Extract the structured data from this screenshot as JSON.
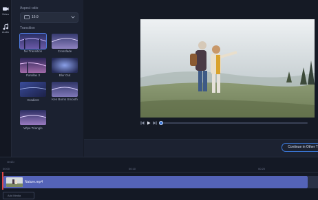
{
  "sidebar": {
    "items": [
      {
        "label": "Video",
        "icon": "video-icon"
      },
      {
        "label": "Audio",
        "icon": "music-note-icon"
      }
    ]
  },
  "panel": {
    "aspect_ratio_label": "Aspect ratio",
    "aspect_ratio_value": "16:9",
    "transition_label": "Transition",
    "transitions": [
      {
        "label": "No Transition",
        "selected": true
      },
      {
        "label": "Crossfade",
        "selected": false
      },
      {
        "label": "Parallax 3",
        "selected": false
      },
      {
        "label": "Blur Out",
        "selected": false
      },
      {
        "label": "Gradient",
        "selected": false
      },
      {
        "label": "Ken Burns Smooth",
        "selected": false
      },
      {
        "label": "Wipe Triangle",
        "selected": false
      }
    ]
  },
  "player": {
    "progress": 0.0
  },
  "actions": {
    "continue_label": "Continue in Other T"
  },
  "timeline": {
    "toolbar_label": "Undo",
    "ticks": [
      "00:00",
      "00:10",
      "00:20"
    ],
    "clip_name": "Nature.mp4",
    "add_button_label": "Add Media"
  },
  "colors": {
    "accent": "#3b78d8",
    "clip": "#5463b8",
    "selection": "#2f6fe0"
  }
}
